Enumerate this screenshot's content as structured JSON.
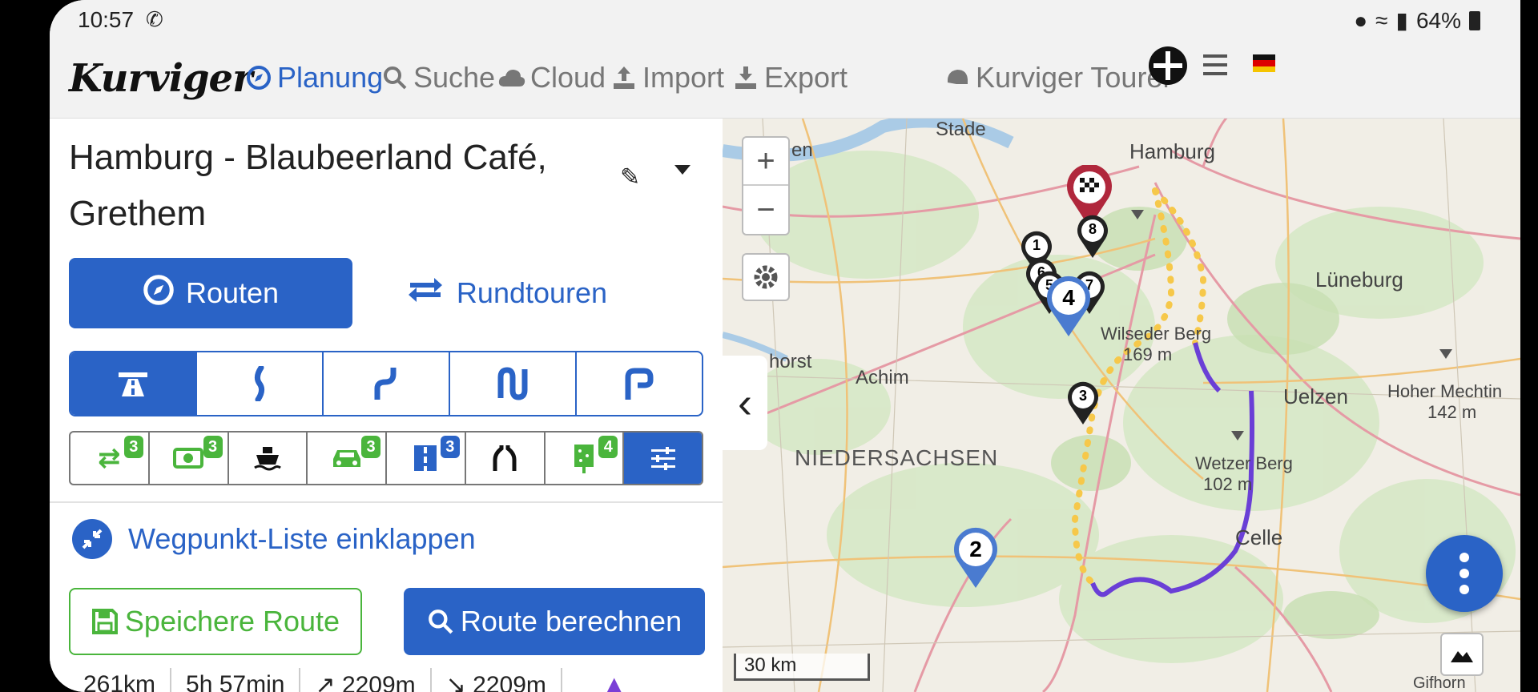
{
  "statusbar": {
    "time": "10:57",
    "battery": "64%"
  },
  "nav": {
    "logo": "Kurviger",
    "planung": "Planung",
    "suche": "Suche",
    "cloud": "Cloud",
    "import": "Import",
    "export": "Export",
    "tourer": "Kurviger Tourer"
  },
  "sidebar": {
    "route_title": "Hamburg - Blaubeerland Café, Grethem",
    "routen_label": "Routen",
    "rundtouren_label": "Rundtouren",
    "options_badges": [
      "3",
      "3",
      "",
      "3",
      "3",
      "",
      "4",
      ""
    ],
    "collapse_label": "Wegpunkt-Liste einklappen",
    "save_label": "Speichere Route",
    "calc_label": "Route berechnen",
    "stats": {
      "distance": "261km",
      "duration": "5h 57min",
      "ascent": "↗ 2209m",
      "descent": "↘ 2209m"
    }
  },
  "map": {
    "zoom_in": "+",
    "zoom_out": "−",
    "scale": "30 km",
    "labels": {
      "stade": "Stade",
      "hamburg": "Hamburg",
      "lueneburg": "Lüneburg",
      "horst": "horst",
      "achim": "Achim",
      "uelzen": "Uelzen",
      "hoher": "Hoher Mechtin",
      "hoher_elev": "142 m",
      "niedersachsen": "NIEDERSACHSEN",
      "wetzer": "Wetzer Berg",
      "wetzer_elev": "102 m",
      "celle": "Celle",
      "wilsede": "Wilseder Berg",
      "wilsede_elev": "169 m",
      "en": "en",
      "ifhorn": "Gifhorn"
    },
    "markers": [
      "1",
      "2",
      "3",
      "4",
      "5",
      "6",
      "7",
      "8"
    ]
  },
  "colors": {
    "primary": "#2a63c6",
    "green": "#4ab53c",
    "route": "#f6c84a"
  }
}
